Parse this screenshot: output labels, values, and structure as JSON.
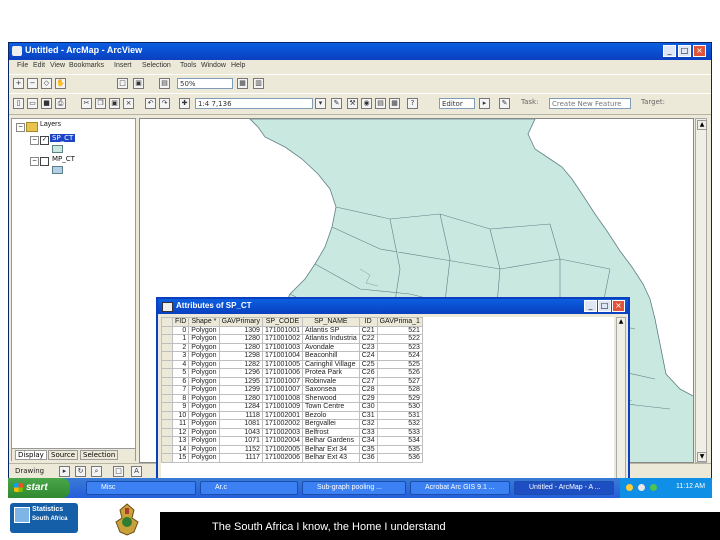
{
  "window": {
    "title": "Untitled - ArcMap - ArcView"
  },
  "menu": [
    "File",
    "Edit",
    "View",
    "Bookmarks",
    "Insert",
    "Selection",
    "Tools",
    "Window",
    "Help"
  ],
  "toolbar": {
    "zoom": "50%",
    "scale": "1:4 7,136",
    "editor_label": "Editor",
    "task_label": "Task:",
    "task_value": "Create New Feature",
    "target_label": "Target:"
  },
  "toc": {
    "root": "Layers",
    "layers": [
      {
        "name": "SP_CT"
      },
      {
        "name": "MP_CT"
      }
    ],
    "tabs": [
      "Display",
      "Source",
      "Selection"
    ]
  },
  "drawing": {
    "label": "Drawing"
  },
  "attr": {
    "title": "Attributes of SP_CT",
    "columns": [
      "FID",
      "Shape *",
      "GAVPrimary",
      "SP_CODE",
      "SP_NAME",
      "ID",
      "GAVPrima_1"
    ],
    "rows": [
      [
        "0",
        "Polygon",
        "1309",
        "171001001",
        "Atlantis SP",
        "C21",
        "521"
      ],
      [
        "1",
        "Polygon",
        "1280",
        "171001002",
        "Atlantis Industria",
        "C22",
        "522"
      ],
      [
        "2",
        "Polygon",
        "1280",
        "171001003",
        "Avondale",
        "C23",
        "523"
      ],
      [
        "3",
        "Polygon",
        "1298",
        "171001004",
        "Beaconhill",
        "C24",
        "524"
      ],
      [
        "4",
        "Polygon",
        "1282",
        "171001005",
        "Caringhil Village",
        "C25",
        "525"
      ],
      [
        "5",
        "Polygon",
        "1296",
        "171001006",
        "Protea Park",
        "C26",
        "526"
      ],
      [
        "6",
        "Polygon",
        "1295",
        "171001007",
        "Robinvale",
        "C27",
        "527"
      ],
      [
        "7",
        "Polygon",
        "1299",
        "171001007",
        "Saxonsea",
        "C28",
        "528"
      ],
      [
        "8",
        "Polygon",
        "1280",
        "171001008",
        "Sherwood",
        "C29",
        "529"
      ],
      [
        "9",
        "Polygon",
        "1284",
        "171001009",
        "Town Centre",
        "C30",
        "530"
      ],
      [
        "10",
        "Polygon",
        "1118",
        "171002001",
        "Bezolo",
        "C31",
        "531"
      ],
      [
        "11",
        "Polygon",
        "1081",
        "171002002",
        "Bergvallei",
        "C32",
        "532"
      ],
      [
        "12",
        "Polygon",
        "1043",
        "171002003",
        "Belfrost",
        "C33",
        "533"
      ],
      [
        "13",
        "Polygon",
        "1071",
        "171002004",
        "Belhar Gardens",
        "C34",
        "534"
      ],
      [
        "14",
        "Polygon",
        "1152",
        "171002005",
        "Belhar Ext 34",
        "C35",
        "535"
      ],
      [
        "15",
        "Polygon",
        "1117",
        "171002006",
        "Belhar Ext 43",
        "C36",
        "536"
      ]
    ]
  },
  "taskbar": {
    "start": "start",
    "items": [
      "Misc",
      "Ar.c",
      "Sub-graph pooling ...",
      "Acrobat Arc GIS 9.1 ...",
      "Untitled - ArcMap - A ..."
    ],
    "clock": "11:12 AM"
  },
  "footer": {
    "logo_line1": "Statistics",
    "logo_line2": "South Africa",
    "tagline": "The South Africa I know, the Home I understand"
  },
  "colors": {
    "map_fill": "#c9e8e0",
    "boundary": "#5f7f86",
    "titlebar": "#0a46d8",
    "footer_bg": "#000000"
  }
}
